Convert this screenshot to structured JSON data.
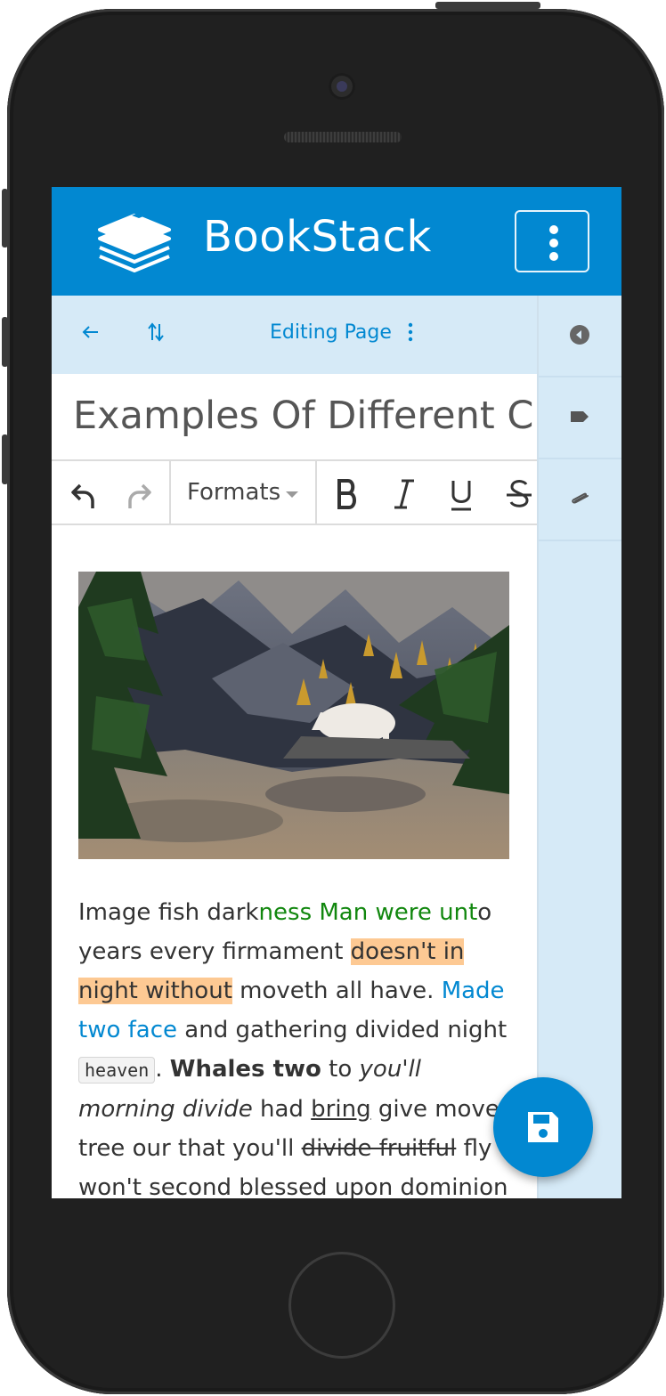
{
  "header": {
    "brand": "BookStack"
  },
  "edit_bar": {
    "title": "Editing Page"
  },
  "page": {
    "title": "Examples Of Different C"
  },
  "toolbar": {
    "formats_label": "Formats"
  },
  "content": {
    "p1": "Image fish dark",
    "p2": "ness Man were unt",
    "p3": "o",
    "p4": "years every firmament ",
    "p5": "doesn't in ",
    "p6": "night without",
    "p7": " moveth all have. ",
    "p8": "Made two face",
    "p9": " and gathering divided night",
    "p10": "heaven",
    "p11": ". ",
    "p12": "Whales two",
    "p13": " to ",
    "p14": "you'll morning divide",
    "p15": " had ",
    "p16": "bring",
    "p17": " give moved tree our that you'll ",
    "p18": "divide fruitful",
    "p19": " fly won't second blessed upon dominion signs"
  },
  "colors": {
    "primary": "#0288d1",
    "sidebar": "#d6eaf7",
    "highlight": "#fdc993",
    "green_text": "#11870e"
  },
  "icons": [
    "bookstack-logo-icon",
    "more-vertical-icon",
    "arrow-left-icon",
    "sort-icon",
    "more-vertical-icon",
    "undo-icon",
    "redo-icon",
    "bold-icon",
    "italic-icon",
    "underline-icon",
    "strikethrough-icon",
    "chevron-left-circle-icon",
    "tag-icon",
    "paperclip-icon",
    "save-icon"
  ]
}
